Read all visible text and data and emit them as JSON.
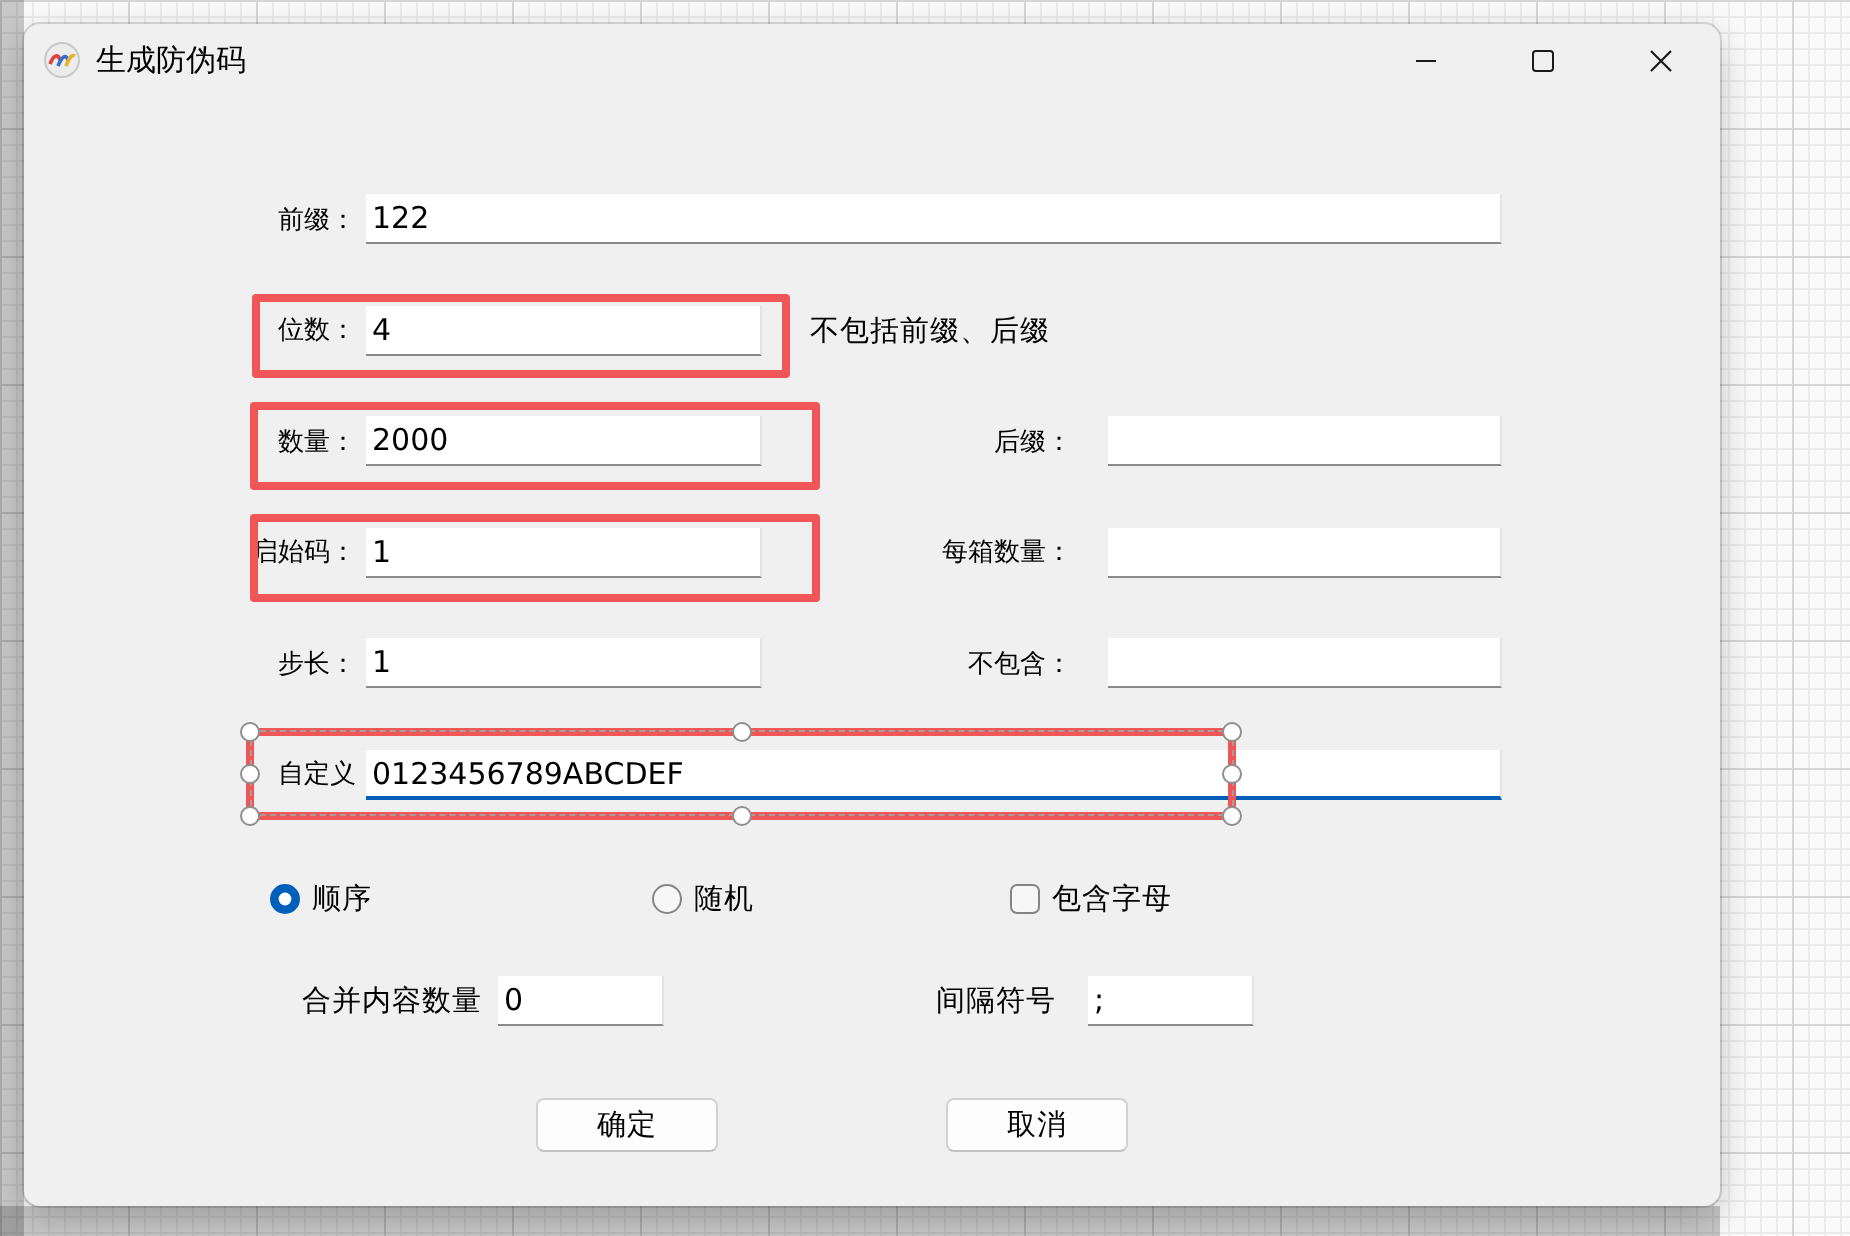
{
  "window": {
    "title": "生成防伪码"
  },
  "rows": [
    {
      "kind": "wide",
      "left": {
        "label": "前缀：",
        "value": "122",
        "focused": false
      },
      "highlighted": false,
      "selected": false
    },
    {
      "kind": "pair",
      "left": {
        "label": "位数：",
        "value": "4",
        "focused": false
      },
      "note": "不包括前缀、后缀",
      "highlighted": true,
      "selected": false
    },
    {
      "kind": "pair",
      "left": {
        "label": "数量：",
        "value": "2000",
        "focused": false
      },
      "right": {
        "label": "后缀：",
        "focused": false
      },
      "highlighted": true,
      "selected": false
    },
    {
      "kind": "pair",
      "left": {
        "label": "启始码：",
        "value": "1",
        "focused": false
      },
      "right": {
        "label": "每箱数量：",
        "focused": false
      },
      "highlighted": true,
      "selected": false
    },
    {
      "kind": "pair",
      "left": {
        "label": "步长：",
        "value": "1",
        "focused": false
      },
      "right": {
        "label": "不包含：",
        "focused": false
      },
      "highlighted": false,
      "selected": false
    },
    {
      "kind": "wide",
      "left": {
        "label": "自定义",
        "value": "0123456789ABCDEF",
        "focused": true
      },
      "highlighted": true,
      "selected": true
    }
  ],
  "options": [
    {
      "kind": "radio",
      "label": "顺序",
      "checked": true
    },
    {
      "kind": "radio",
      "label": "随机",
      "checked": false
    },
    {
      "kind": "checkbox",
      "label": "包含字母",
      "checked": false
    }
  ],
  "extra_fields": [
    {
      "label": "合并内容数量",
      "value": "0",
      "focused": false
    },
    {
      "label": "间隔符号",
      "value": ";",
      "focused": false
    }
  ],
  "buttons": [
    "确定",
    "取消"
  ]
}
